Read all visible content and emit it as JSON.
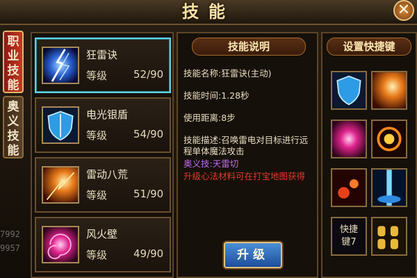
{
  "window": {
    "title": "技能",
    "close_label": "✕"
  },
  "tabs": [
    {
      "line1": "职",
      "line2": "业",
      "line3": "技",
      "line4": "能"
    },
    {
      "line1": "奥",
      "line2": "义",
      "line3": "技",
      "line4": "能"
    }
  ],
  "side_numbers": [
    "7992",
    "9957"
  ],
  "skills": [
    {
      "name": "狂雷诀",
      "level_label": "等级",
      "level": "52/90",
      "icon": "lightning-icon"
    },
    {
      "name": "电光银盾",
      "level_label": "等级",
      "level": "54/90",
      "icon": "blue-shield-icon"
    },
    {
      "name": "雷动八荒",
      "level_label": "等级",
      "level": "51/90",
      "icon": "fire-burst-icon"
    },
    {
      "name": "风火壁",
      "level_label": "等级",
      "level": "49/90",
      "icon": "pink-vortex-icon"
    }
  ],
  "description": {
    "header": "技能说明",
    "name": "技能名称:狂雷诀(主动)",
    "time": "技能时间:1.28秒",
    "range": "使用距离:8步",
    "desc_line1": "技能描述:召唤雷电对目标进行远",
    "desc_line2": "程单体魔法攻击",
    "ultimate": "奥义技:天雷切",
    "upgrade_hint": "升级心法材料可在打宝地图获得"
  },
  "upgrade_button": "升级",
  "hotkeys": {
    "header": "设置快捷键",
    "empty_slot_line1": "快捷",
    "empty_slot_line2": "键7"
  },
  "colors": {
    "accent_gold": "#f7e3a8",
    "selected_cyan": "#5fd3e0",
    "ultimate_purple": "#c26bf0",
    "hint_red": "#e23a2a"
  }
}
